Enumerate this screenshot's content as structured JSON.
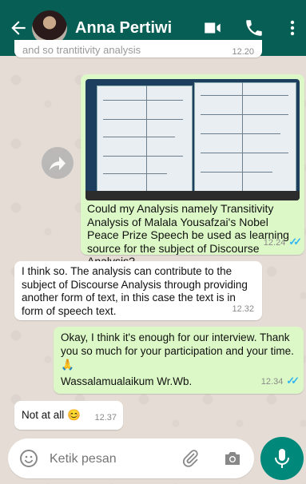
{
  "header": {
    "contact_name": "Anna Pertiwi",
    "icons": [
      "back-arrow-icon",
      "video-call-icon",
      "phone-icon",
      "more-vert-icon"
    ]
  },
  "messages": [
    {
      "type": "in",
      "text": "Could my Analysis namely Transitivity Analysis of Malala Yousafzai's Nobel Peace Prize Speech be used as learning source for the subject of Discourse Analysis?",
      "time": "12.24"
    },
    {
      "type": "in",
      "text": "I think so. The analysis can contribute to the subject of Discourse Analysis through providing another form of text, in this case the text is in form of speech text.",
      "time": "12.32"
    },
    {
      "type": "out",
      "text": "Okay, I think it's enough for our interview. Thank you so much for your  participation and your time. 🙏",
      "text2": "Wassalamualaikum Wr.Wb.",
      "time": "12.34"
    },
    {
      "type": "in",
      "text": "Not at all 😊",
      "time": "12.37"
    }
  ],
  "top_partial": {
    "text": "and so trantitivity analysis",
    "time": "12.20"
  },
  "input": {
    "placeholder": "Ketik pesan"
  },
  "colors": {
    "header": "#075e54",
    "outgoing": "#dcf8c6",
    "incoming": "#ffffff",
    "ticks": "#34b7f1",
    "mic": "#00897b"
  }
}
